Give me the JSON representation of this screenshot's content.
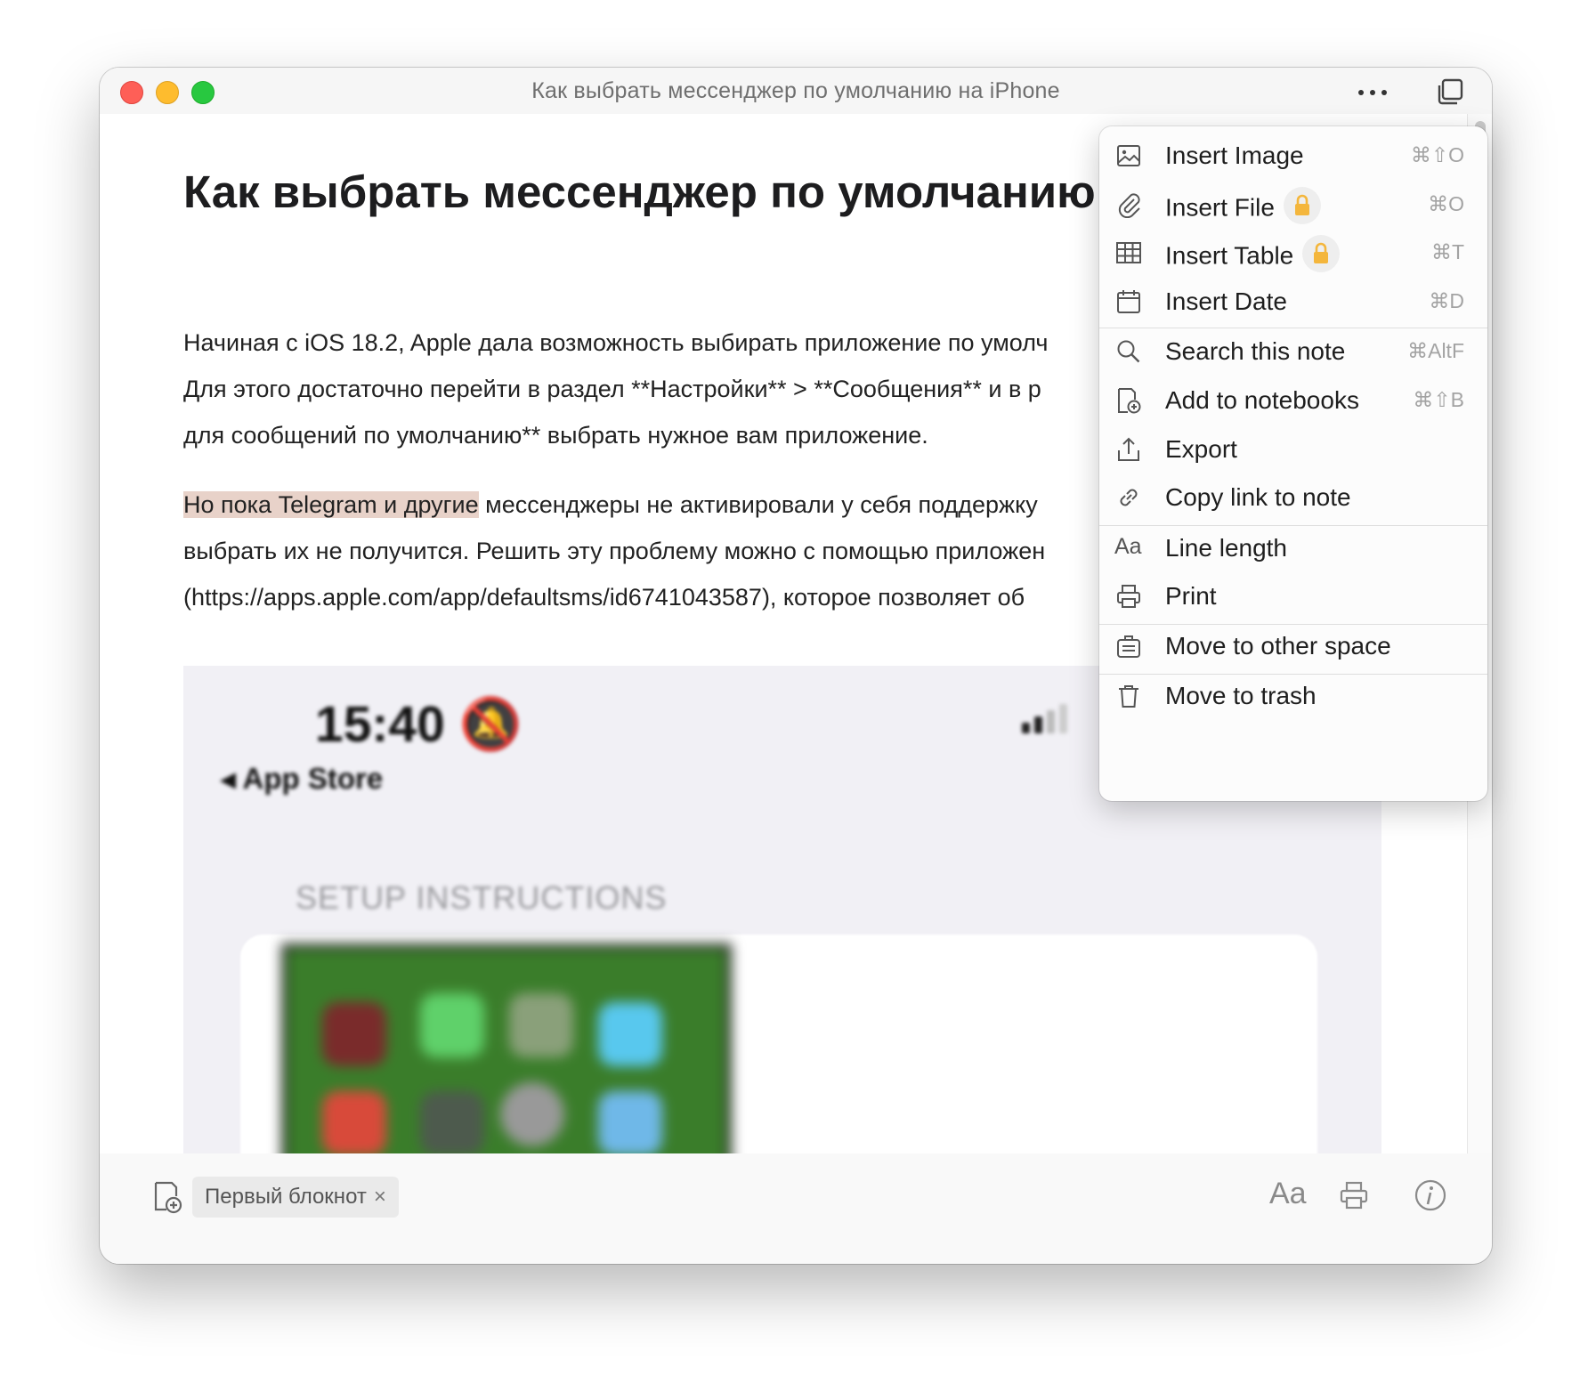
{
  "window": {
    "title": "Как выбрать мессенджер по умолчанию на iPhone"
  },
  "note": {
    "title": "Как выбрать мессенджер по умолчанию",
    "paragraph1": [
      "Начиная с iOS 18.2, Apple дала возможность выбирать приложение по умолч",
      "Для этого достаточно перейти в раздел **Настройки** > **Сообщения** и в р",
      "для сообщений по умолчанию** выбрать нужное вам приложение."
    ],
    "paragraph2": {
      "highlighted": "Но пока Telegram и другие",
      "line1_rest": " мессенджеры не активировали у себя поддержку",
      "line2": "выбрать их не получится. Решить эту проблему можно с помощью приложен",
      "line3": "(https://apps.apple.com/app/defaultsms/id6741043587), которое позволяет об"
    },
    "highlight_color": "#e8d2c9"
  },
  "embedded_screenshot": {
    "time": "15:40",
    "back_label": "◂ App Store",
    "section_header": "SETUP INSTRUCTIONS"
  },
  "menu": {
    "items": [
      {
        "label": "Insert Image",
        "shortcut": "⌘⇧O",
        "icon": "image-icon"
      },
      {
        "label": "Insert File",
        "shortcut": "⌘O",
        "icon": "paperclip-icon",
        "locked": true
      },
      {
        "label": "Insert Table",
        "shortcut": "⌘T",
        "icon": "table-icon",
        "locked": true
      },
      {
        "label": "Insert Date",
        "shortcut": "⌘D",
        "icon": "calendar-icon"
      },
      {
        "label": "Search this note",
        "shortcut": "⌘AltF",
        "icon": "search-icon"
      },
      {
        "label": "Add to notebooks",
        "shortcut": "⌘⇧B",
        "icon": "add-notebook-icon"
      },
      {
        "label": "Export",
        "shortcut": "",
        "icon": "export-icon"
      },
      {
        "label": "Copy link to note",
        "shortcut": "",
        "icon": "link-icon"
      },
      {
        "label": "Line length",
        "shortcut": "",
        "icon": "text-size-icon"
      },
      {
        "label": "Print",
        "shortcut": "",
        "icon": "printer-icon"
      },
      {
        "label": "Move to other space",
        "shortcut": "",
        "icon": "briefcase-icon"
      },
      {
        "label": "Move to trash",
        "shortcut": "",
        "icon": "trash-icon"
      }
    ],
    "lock_color": "#f4b63c"
  },
  "bottombar": {
    "notebook_chip": "Первый блокнот",
    "chip_remove": "×",
    "format_label": "Aa"
  },
  "colors": {
    "traffic_red": "#fe5f57",
    "traffic_yellow": "#febc2e",
    "traffic_green": "#28c840"
  }
}
